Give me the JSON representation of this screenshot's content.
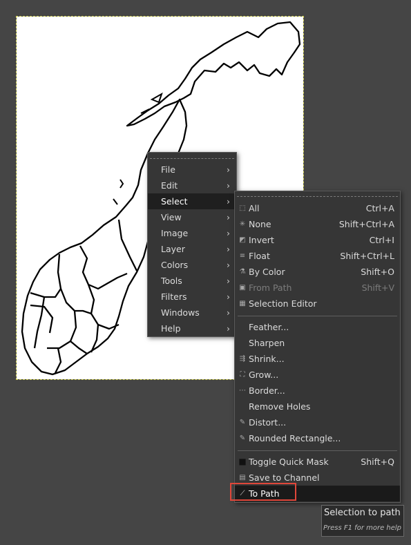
{
  "image_menu_bar": [
    {
      "label": "File"
    },
    {
      "label": "Edit"
    },
    {
      "label": "Select",
      "active": true
    },
    {
      "label": "View"
    },
    {
      "label": "Image"
    },
    {
      "label": "Layer"
    },
    {
      "label": "Colors"
    },
    {
      "label": "Tools"
    },
    {
      "label": "Filters"
    },
    {
      "label": "Windows"
    },
    {
      "label": "Help"
    }
  ],
  "select_menu": {
    "group1": [
      {
        "label": "All",
        "shortcut": "Ctrl+A",
        "icon": "select-all-icon"
      },
      {
        "label": "None",
        "shortcut": "Shift+Ctrl+A",
        "icon": "select-none-icon"
      },
      {
        "label": "Invert",
        "shortcut": "Ctrl+I",
        "icon": "invert-icon"
      },
      {
        "label": "Float",
        "shortcut": "Shift+Ctrl+L",
        "icon": "float-icon"
      },
      {
        "label": "By Color",
        "shortcut": "Shift+O",
        "icon": "by-color-icon"
      },
      {
        "label": "From Path",
        "shortcut": "Shift+V",
        "icon": "from-path-icon",
        "disabled": true
      },
      {
        "label": "Selection Editor",
        "shortcut": "",
        "icon": "selection-editor-icon"
      }
    ],
    "group2": [
      {
        "label": "Feather...",
        "shortcut": "",
        "icon": ""
      },
      {
        "label": "Sharpen",
        "shortcut": "",
        "icon": ""
      },
      {
        "label": "Shrink...",
        "shortcut": "",
        "icon": "shrink-icon"
      },
      {
        "label": "Grow...",
        "shortcut": "",
        "icon": "grow-icon"
      },
      {
        "label": "Border...",
        "shortcut": "",
        "icon": "border-icon"
      },
      {
        "label": "Remove Holes",
        "shortcut": "",
        "icon": ""
      },
      {
        "label": "Distort...",
        "shortcut": "",
        "icon": "distort-icon"
      },
      {
        "label": "Rounded Rectangle...",
        "shortcut": "",
        "icon": "rounded-rectangle-icon"
      }
    ],
    "group3": [
      {
        "label": "Toggle Quick Mask",
        "shortcut": "Shift+Q",
        "icon": "quick-mask-icon"
      },
      {
        "label": "Save to Channel",
        "shortcut": "",
        "icon": "save-channel-icon"
      },
      {
        "label": "To Path",
        "shortcut": "",
        "icon": "to-path-icon",
        "highlighted": true
      }
    ]
  },
  "tooltip": {
    "title": "Selection to path",
    "hint": "Press F1 for more help"
  },
  "colors": {
    "background": "#454545",
    "menu_bg": "#363636",
    "highlight_box": "#e0473a",
    "selection_marching_ants": "#c9c94a"
  }
}
